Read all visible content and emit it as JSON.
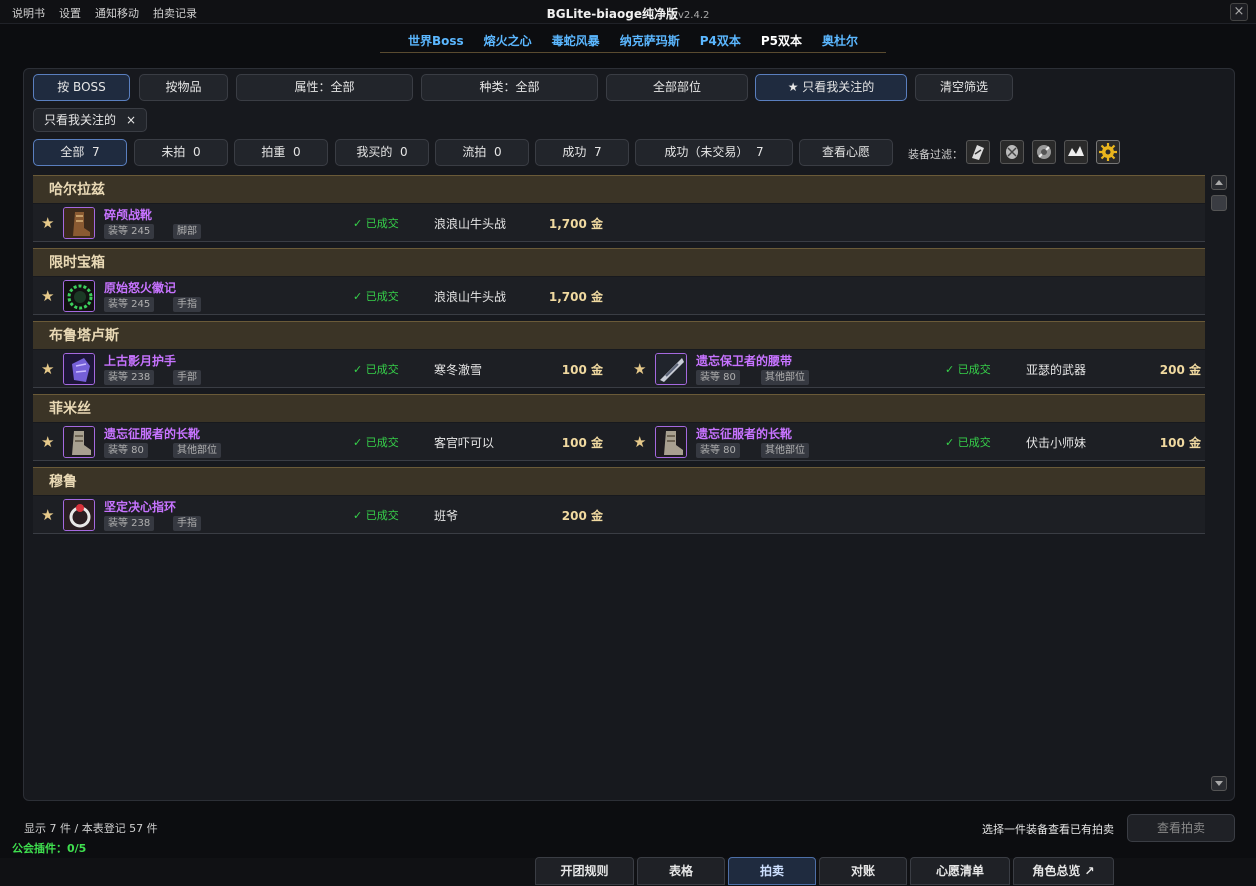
{
  "window": {
    "title": "BGLite-biaoge纯净版",
    "version": "v2.4.2",
    "close": "×"
  },
  "topmenu": [
    "说明书",
    "设置",
    "通知移动",
    "拍卖记录"
  ],
  "raid_tabs": [
    {
      "label": "世界Boss",
      "active": false
    },
    {
      "label": "熔火之心",
      "active": false
    },
    {
      "label": "毒蛇风暴",
      "active": false
    },
    {
      "label": "纳克萨玛斯",
      "active": false
    },
    {
      "label": "P4双本",
      "active": false
    },
    {
      "label": "P5双本",
      "active": true
    },
    {
      "label": "奥杜尔",
      "active": false
    }
  ],
  "filters": {
    "by_boss": "按 BOSS",
    "by_item": "按物品",
    "attribute": "属性：全部",
    "kind": "种类：全部",
    "slot": "全部部位",
    "watched_only": "★ 只看我关注的",
    "clear": "清空筛选",
    "active_tag": "只看我关注的",
    "active_tag_close": "×"
  },
  "status_tabs": [
    {
      "label": "全部",
      "count": "7"
    },
    {
      "label": "未拍",
      "count": "0"
    },
    {
      "label": "拍重",
      "count": "0"
    },
    {
      "label": "我买的",
      "count": "0"
    },
    {
      "label": "流拍",
      "count": "0"
    },
    {
      "label": "成功",
      "count": "7"
    },
    {
      "label": "成功（未交易）",
      "count": "7"
    }
  ],
  "wishlist_btn": "查看心愿",
  "equip_filter_label": "装备过滤：",
  "groups": [
    {
      "name": "哈尔拉兹",
      "items": [
        {
          "name": "碎颅战靴",
          "ilvl": "装等 245",
          "slot": "脚部",
          "status": "已成交",
          "buyer": "浪浪山牛头战",
          "price": "1,700 金",
          "icon": "boots-icon"
        }
      ]
    },
    {
      "name": "限时宝箱",
      "items": [
        {
          "name": "原始怒火徽记",
          "ilvl": "装等 245",
          "slot": "手指",
          "status": "已成交",
          "buyer": "浪浪山牛头战",
          "price": "1,700 金",
          "icon": "sigil-icon"
        }
      ]
    },
    {
      "name": "布鲁塔卢斯",
      "items": [
        {
          "name": "上古影月护手",
          "ilvl": "装等 238",
          "slot": "手部",
          "status": "已成交",
          "buyer": "寒冬澈雪",
          "price": "100 金",
          "icon": "gauntlet-icon"
        },
        {
          "name": "遗忘保卫者的腰带",
          "ilvl": "装等 80",
          "slot": "其他部位",
          "status": "已成交",
          "buyer": "亚瑟的武器",
          "price": "200 金",
          "icon": "belt-icon"
        }
      ]
    },
    {
      "name": "菲米丝",
      "items": [
        {
          "name": "遗忘征服者的长靴",
          "ilvl": "装等 80",
          "slot": "其他部位",
          "status": "已成交",
          "buyer": "客官吓可以",
          "price": "100 金",
          "icon": "boots-icon"
        },
        {
          "name": "遗忘征服者的长靴",
          "ilvl": "装等 80",
          "slot": "其他部位",
          "status": "已成交",
          "buyer": "伏击小师妹",
          "price": "100 金",
          "icon": "boots-icon"
        }
      ]
    },
    {
      "name": "穆鲁",
      "items": [
        {
          "name": "坚定决心指环",
          "ilvl": "装等 238",
          "slot": "手指",
          "status": "已成交",
          "buyer": "班爷",
          "price": "200 金",
          "icon": "ring-icon"
        }
      ]
    }
  ],
  "footer": {
    "count": "显示 7 件 / 本表登记 57 件",
    "guild": "公会插件：0/5",
    "hint": "选择一件装备查看已有拍卖",
    "view_btn": "查看拍卖"
  },
  "bottom_tabs": [
    {
      "label": "开团规则",
      "active": false
    },
    {
      "label": "表格",
      "active": false
    },
    {
      "label": "拍卖",
      "active": true
    },
    {
      "label": "对账",
      "active": false
    },
    {
      "label": "心愿清单",
      "active": false
    },
    {
      "label": "角色总览 ↗",
      "active": false
    }
  ],
  "colors": {
    "epic": "#c773ff",
    "success": "#36d14a",
    "gold": "#f0d9a0",
    "raid_tab": "#5bb7ff"
  }
}
